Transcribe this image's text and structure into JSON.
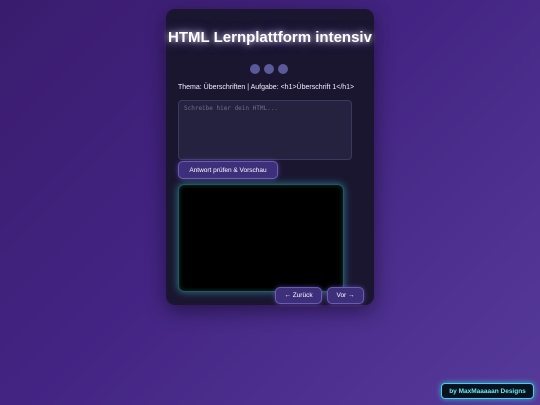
{
  "app": {
    "title": "HTML Lernplattform intensiv"
  },
  "progress": {
    "total_steps": 3,
    "current_step": 0
  },
  "task": {
    "label": "Thema: Überschriften | Aufgabe: <h1>Überschrift 1</h1>"
  },
  "editor": {
    "placeholder": "Schreibe hier dein HTML...",
    "value": ""
  },
  "actions": {
    "check_label": "Antwort prüfen & Vorschau",
    "back_label": "← Zurück",
    "next_label": "Vor →"
  },
  "footer": {
    "credit": "by MaxMaaaaan Designs"
  },
  "colors": {
    "background_start": "#3a1c6e",
    "background_end": "#563a9a",
    "card": "#1a1630",
    "button": "#3e2f7a",
    "accent_cyan": "#2fd9e6"
  }
}
